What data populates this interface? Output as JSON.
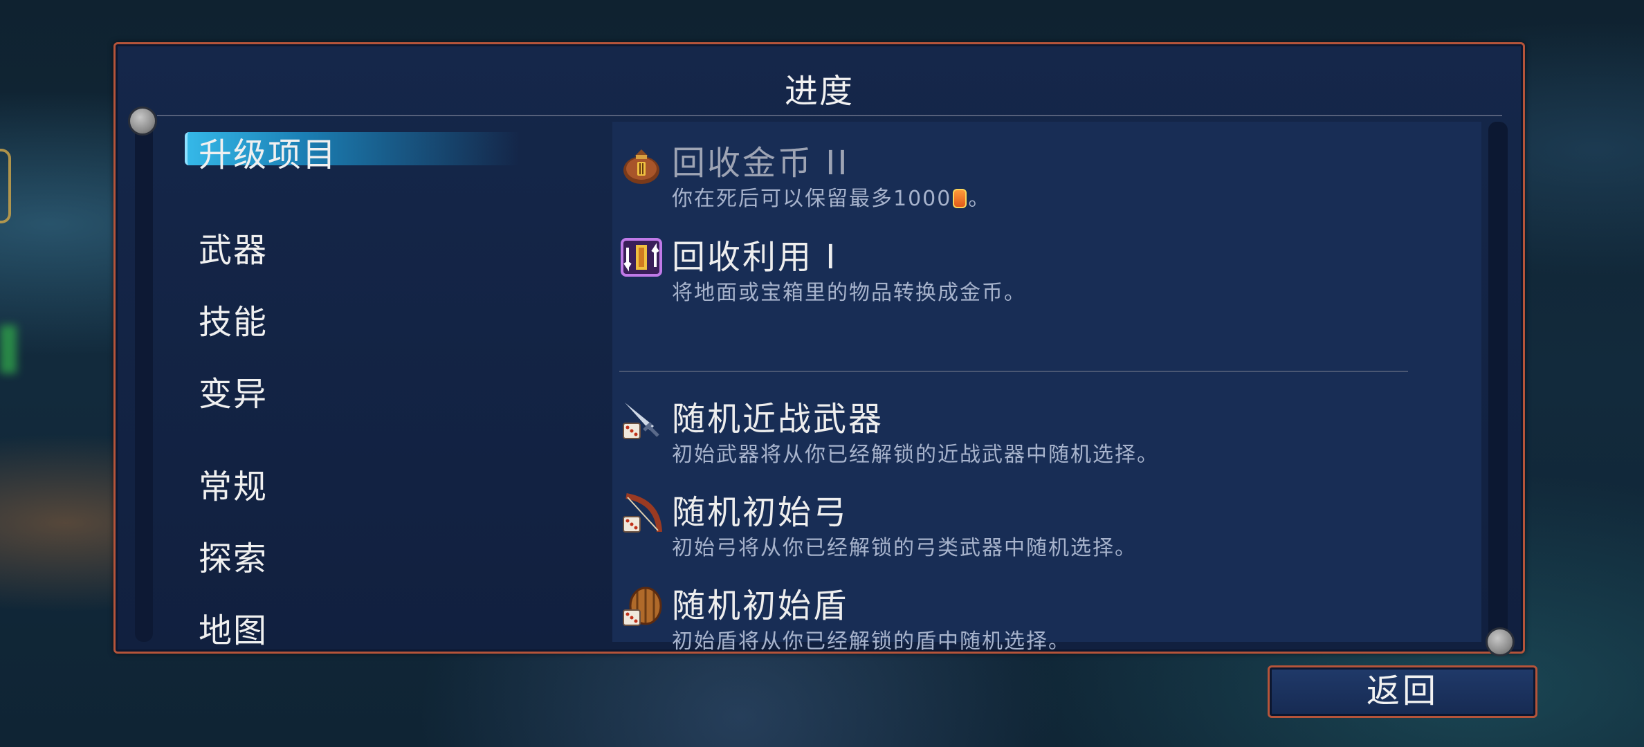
{
  "panel": {
    "title": "进度"
  },
  "nav": {
    "items": [
      {
        "label": "升级项目",
        "active": true
      },
      {
        "label": "武器"
      },
      {
        "label": "技能"
      },
      {
        "label": "变异"
      },
      {
        "label": "常规"
      },
      {
        "label": "探索"
      },
      {
        "label": "地图"
      }
    ]
  },
  "entries": [
    {
      "name": "回收金币 II",
      "desc_prefix": "你在死后可以保留最多1000",
      "desc_suffix": "。",
      "icon": "gold-bag-icon",
      "locked": true
    },
    {
      "name": "回收利用 I",
      "desc": "将地面或宝箱里的物品转换成金币。",
      "icon": "recycle-scroll-icon"
    },
    {
      "name": "随机近战武器",
      "desc": "初始武器将从你已经解锁的近战武器中随机选择。",
      "icon": "random-sword-icon"
    },
    {
      "name": "随机初始弓",
      "desc": "初始弓将从你已经解锁的弓类武器中随机选择。",
      "icon": "random-bow-icon"
    },
    {
      "name": "随机初始盾",
      "desc": "初始盾将从你已经解锁的盾中随机选择。",
      "icon": "random-shield-icon"
    }
  ],
  "footer": {
    "back_label": "返回"
  },
  "colors": {
    "panel_border": "#b5543a",
    "nav_active": "#35b8e8",
    "text": "#f0f0f0"
  }
}
